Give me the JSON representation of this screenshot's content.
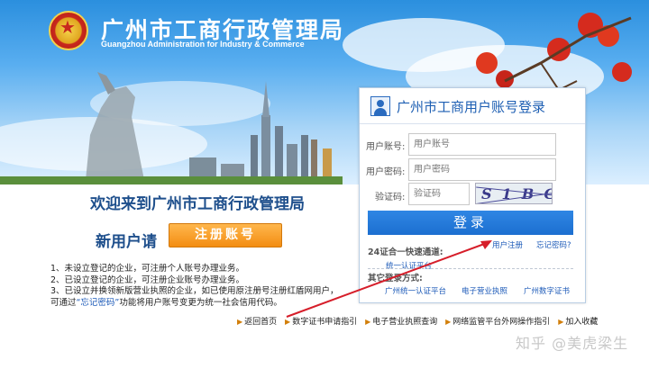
{
  "header": {
    "title": "广州市工商行政管理局",
    "subtitle_en": "Guangzhou Administration for Industry & Commerce"
  },
  "welcome": {
    "heading": "欢迎来到广州市工商行政管理局",
    "new_user_prompt": "新用户请",
    "register_label": "注册账号"
  },
  "notes": {
    "line1": "1、未设立登记的企业，可注册个人账号办理业务。",
    "line2": "2、已设立登记的企业，可注册企业账号办理业务。",
    "line3": "3、已设立并换领新版营业执照的企业，如已使用原注册号注册红盾网用户，",
    "line4_prefix": "可通过",
    "line4_link": "“忘记密码”",
    "line4_suffix": "功能将用户账号变更为统一社会信用代码。"
  },
  "login": {
    "title": "广州市工商用户账号登录",
    "username_label": "用户账号:",
    "username_placeholder": "用户账号",
    "password_label": "用户密码:",
    "password_placeholder": "用户密码",
    "captcha_label": "验证码:",
    "captcha_placeholder": "验证码",
    "captcha_text": "S1BG",
    "login_label": "登录",
    "section1_title": "24证合一快速通道:",
    "register_link": "用户注册",
    "forgot_link": "忘记密码?",
    "unified_auth_link": "统一认证平台",
    "section2_title": "其它登录方式:",
    "alt_login": [
      "广州统一认证平台",
      "电子营业执照",
      "广州数字证书"
    ]
  },
  "footer": {
    "links": [
      "返回首页",
      "数字证书申请指引",
      "电子营业执照查询",
      "网络监管平台外网操作指引",
      "加入收藏"
    ]
  },
  "watermark": "知乎 @美虎梁生",
  "colors": {
    "accent_blue": "#1e5fb3",
    "button_orange": "#f38d12",
    "annotation_red": "#d61e2a"
  }
}
